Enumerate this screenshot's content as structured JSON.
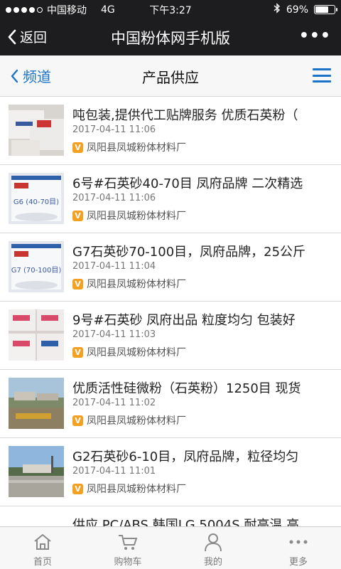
{
  "status_bar": {
    "carrier": "中国移动",
    "network": "4G",
    "time": "下午3:27",
    "battery": "69%",
    "battery_level": 0.69,
    "signal_bars": 4
  },
  "nav": {
    "back_label": "返回",
    "title": "中国粉体网手机版",
    "more_label": "•••"
  },
  "subheader": {
    "channel_label": "频道",
    "title": "产品供应"
  },
  "products": [
    {
      "title": "吨包装,提供代工贴牌服务 优质石英粉（",
      "date": "2017-04-11 11:06",
      "seller": "凤阳县凤城粉体材料厂",
      "thumb_style": "sacks-white"
    },
    {
      "title": "6号#石英砂40-70目 凤府品牌 二次精选",
      "date": "2017-04-11 11:06",
      "seller": "凤阳县凤城粉体材料厂",
      "thumb_style": "label-g6",
      "thumb_text": "G6 (40-70目)"
    },
    {
      "title": "G7石英砂70-100目，凤府品牌，25公斤",
      "date": "2017-04-11 11:04",
      "seller": "凤阳县凤城粉体材料厂",
      "thumb_style": "label-g7",
      "thumb_text": "G7 (70-100目)"
    },
    {
      "title": "9号#石英砂 凤府出品 粒度均匀 包装好",
      "date": "2017-04-11 11:03",
      "seller": "凤阳县凤城粉体材料厂",
      "thumb_style": "sacks-pink"
    },
    {
      "title": "优质活性硅微粉（石英粉）1250目 现货",
      "date": "2017-04-11 11:02",
      "seller": "凤阳县凤城粉体材料厂",
      "thumb_style": "factory-yard"
    },
    {
      "title": "G2石英砂6-10目，凤府品牌，粒径均匀",
      "date": "2017-04-11 11:01",
      "seller": "凤阳县凤城粉体材料厂",
      "thumb_style": "factory-sky"
    },
    {
      "title": "供应 PC/ABS 韩国LG 5004S 耐高温 高",
      "date": "",
      "seller": "",
      "thumb_style": "none"
    }
  ],
  "tabs": [
    {
      "label": "首页",
      "icon": "home-icon"
    },
    {
      "label": "购物车",
      "icon": "cart-icon"
    },
    {
      "label": "我的",
      "icon": "user-icon"
    },
    {
      "label": "更多",
      "icon": "more-icon"
    }
  ],
  "colors": {
    "accent": "#1a73c8",
    "dark_bar": "#1d1d1f",
    "verified_badge": "#f4a020"
  }
}
